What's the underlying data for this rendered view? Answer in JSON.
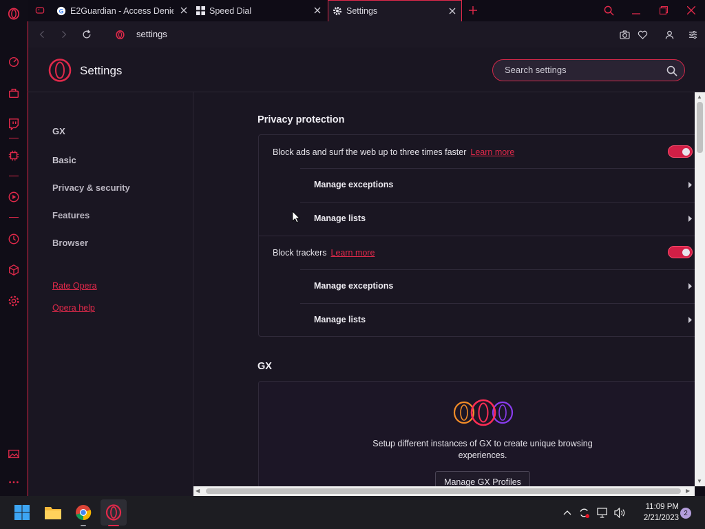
{
  "colors": {
    "accent": "#e0294a",
    "background": "#1a1622",
    "sidebar": "#100d17",
    "taskbar": "#1d1d22"
  },
  "tabs": [
    {
      "label": "E2Guardian - Access Denied",
      "icon": "google-icon",
      "active": false
    },
    {
      "label": "Speed Dial",
      "icon": "speed-dial-icon",
      "active": false
    },
    {
      "label": "Settings",
      "icon": "gear-icon",
      "active": true
    }
  ],
  "address": {
    "url": "settings"
  },
  "header": {
    "title": "Settings",
    "search_placeholder": "Search settings"
  },
  "nav": {
    "items": [
      "GX",
      "Basic",
      "Privacy & security",
      "Features",
      "Browser"
    ],
    "links": [
      "Rate Opera",
      "Opera help"
    ]
  },
  "privacy": {
    "title": "Privacy protection",
    "block_ads": {
      "label": "Block ads and surf the web up to three times faster",
      "link": "Learn more",
      "enabled": true
    },
    "block_trackers": {
      "label": "Block trackers",
      "link": "Learn more",
      "enabled": true
    },
    "manage_exceptions": "Manage exceptions",
    "manage_lists": "Manage lists"
  },
  "gx": {
    "title": "GX",
    "description": "Setup different instances of GX to create unique browsing experiences.",
    "button": "Manage GX Profiles"
  },
  "taskbar": {
    "time": "11:09 PM",
    "date": "2/21/2023",
    "notifications": "2"
  }
}
